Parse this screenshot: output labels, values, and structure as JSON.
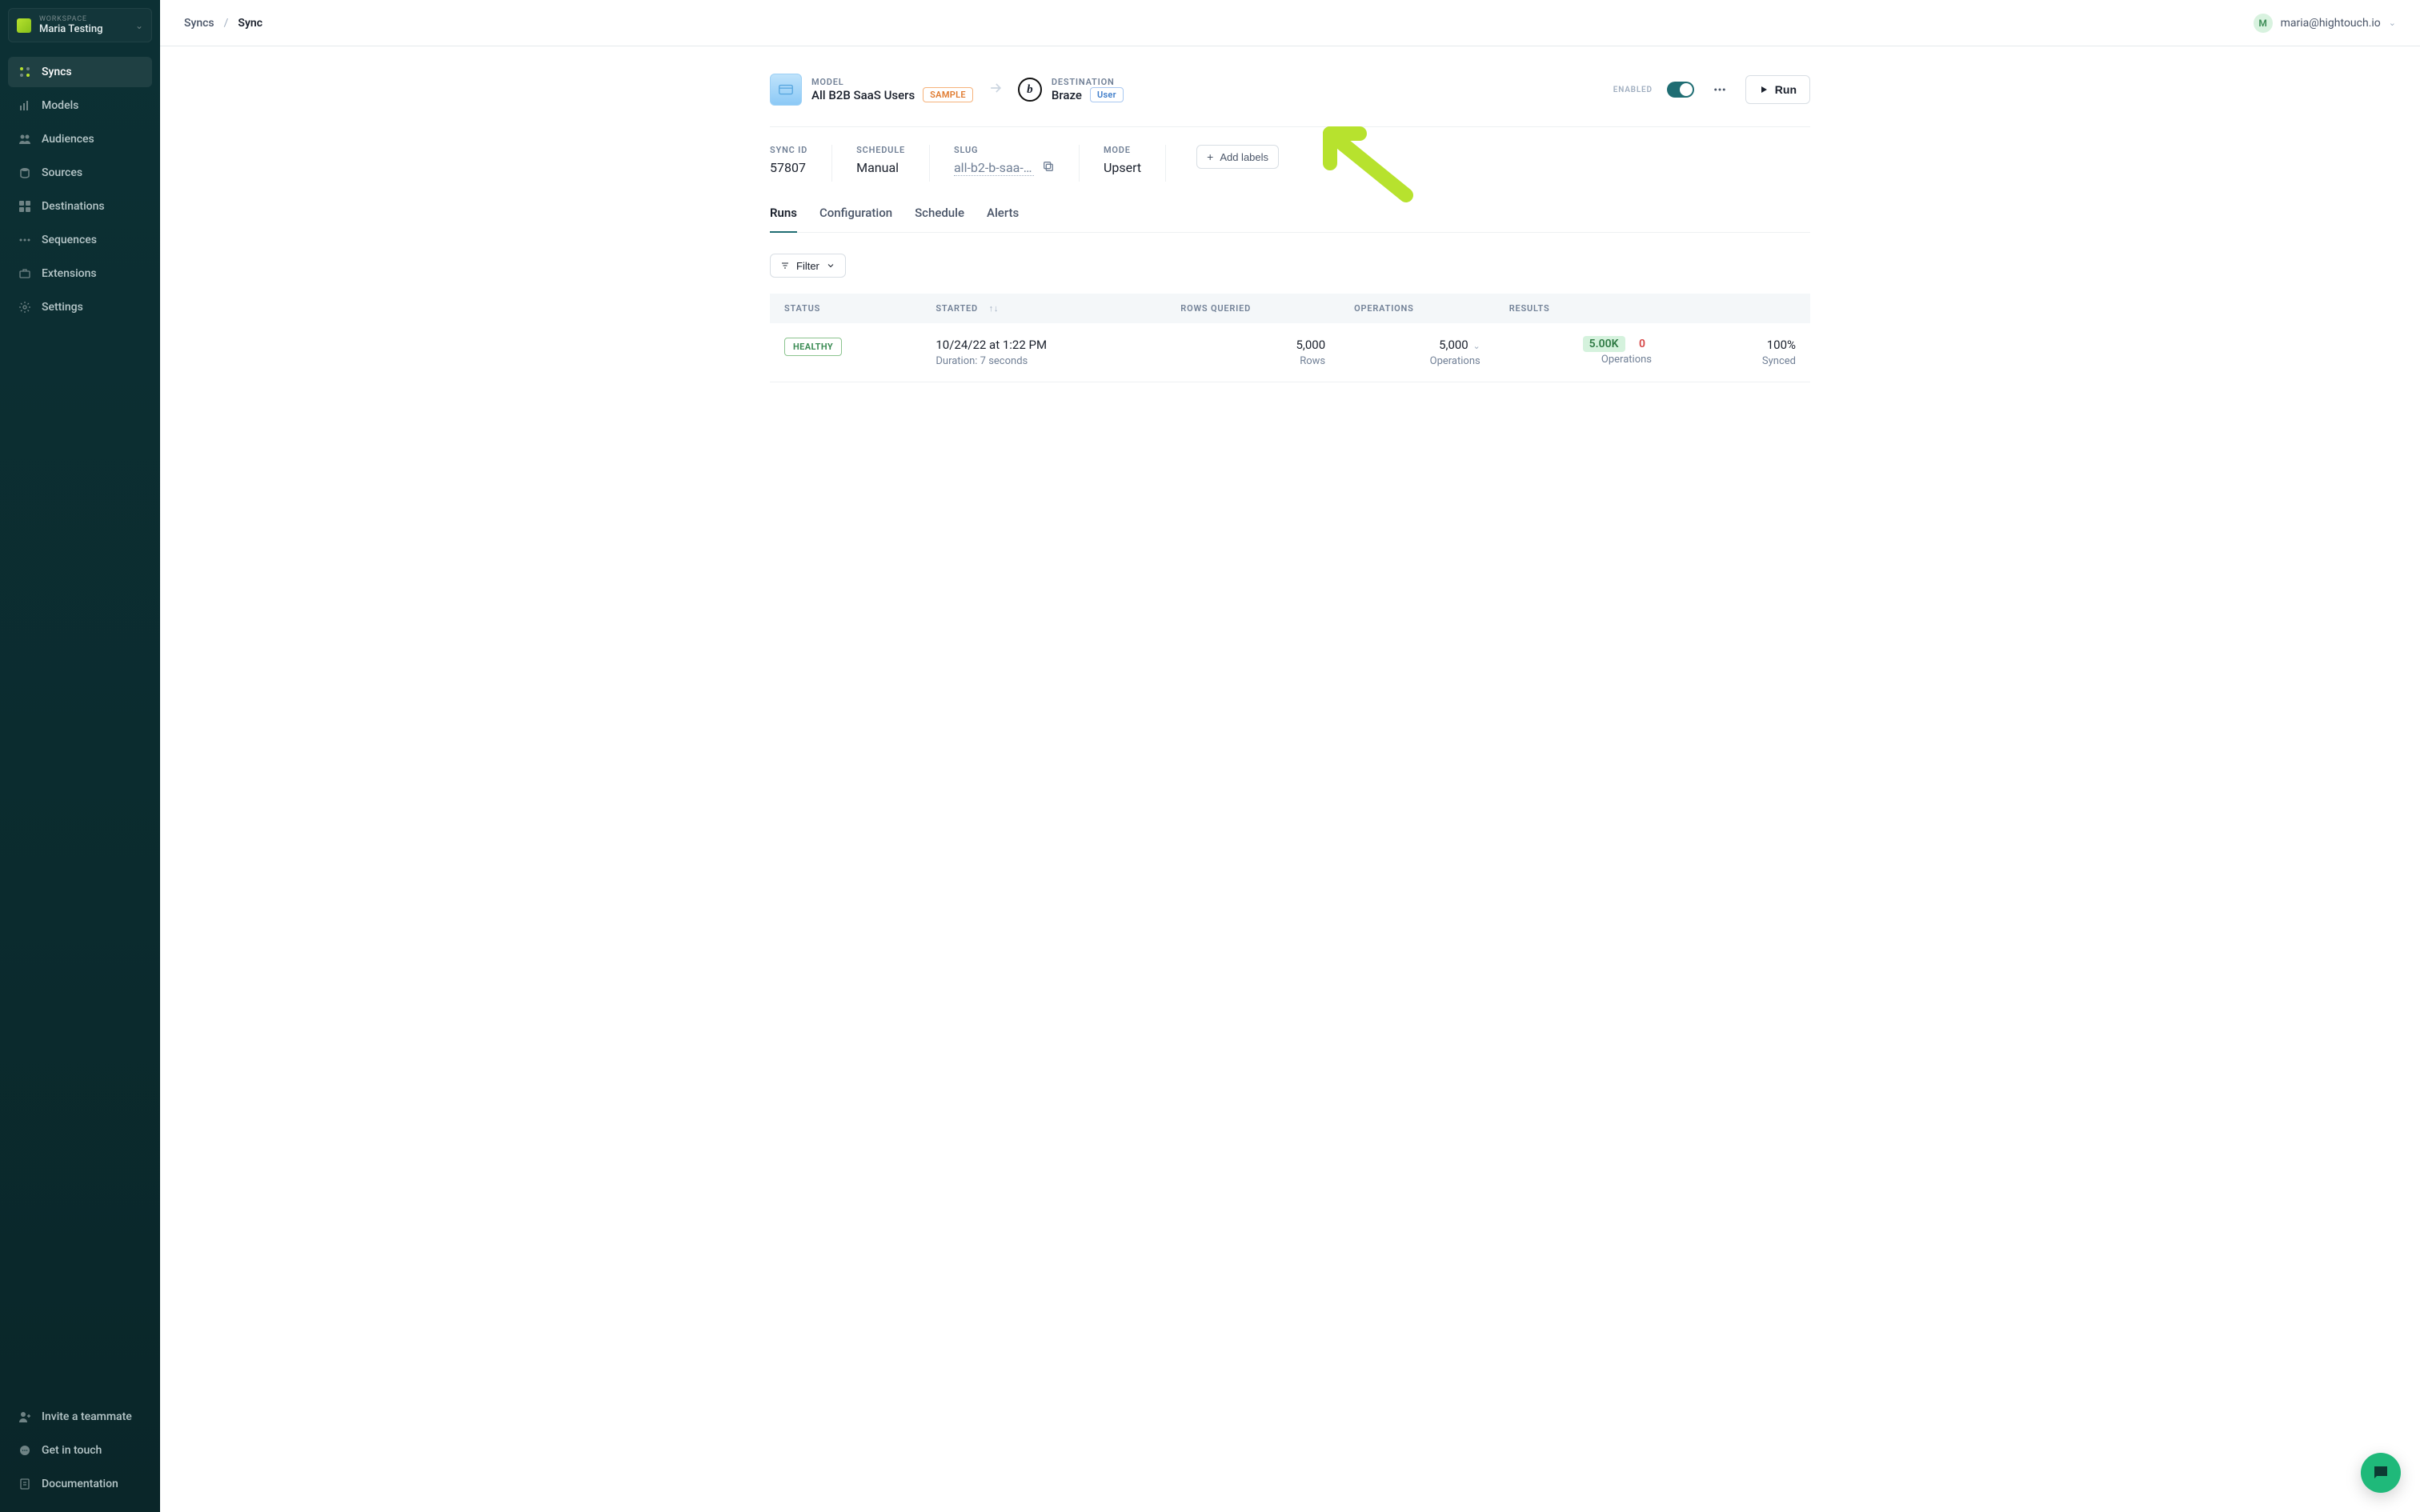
{
  "workspace": {
    "label": "WORKSPACE",
    "name": "Maria Testing"
  },
  "nav": {
    "items": [
      {
        "id": "syncs",
        "label": "Syncs"
      },
      {
        "id": "models",
        "label": "Models"
      },
      {
        "id": "audiences",
        "label": "Audiences"
      },
      {
        "id": "sources",
        "label": "Sources"
      },
      {
        "id": "destinations",
        "label": "Destinations"
      },
      {
        "id": "sequences",
        "label": "Sequences"
      },
      {
        "id": "extensions",
        "label": "Extensions"
      },
      {
        "id": "settings",
        "label": "Settings"
      }
    ],
    "footer": [
      {
        "id": "invite",
        "label": "Invite a teammate"
      },
      {
        "id": "touch",
        "label": "Get in touch"
      },
      {
        "id": "docs",
        "label": "Documentation"
      }
    ]
  },
  "breadcrumb": {
    "parent": "Syncs",
    "current": "Sync"
  },
  "user": {
    "initial": "M",
    "email": "maria@hightouch.io"
  },
  "header": {
    "model_label": "MODEL",
    "model_name": "All B2B SaaS Users",
    "sample_tag": "SAMPLE",
    "dest_label": "DESTINATION",
    "dest_name": "Braze",
    "dest_obj_tag": "User",
    "enabled_label": "ENABLED",
    "run_label": "Run"
  },
  "meta": {
    "sync_id_label": "SYNC ID",
    "sync_id": "57807",
    "schedule_label": "SCHEDULE",
    "schedule": "Manual",
    "slug_label": "SLUG",
    "slug": "all-b2-b-saa-s…",
    "mode_label": "MODE",
    "mode": "Upsert",
    "add_labels": "Add labels"
  },
  "tabs": {
    "runs": "Runs",
    "configuration": "Configuration",
    "schedule": "Schedule",
    "alerts": "Alerts"
  },
  "filter_label": "Filter",
  "table": {
    "headers": {
      "status": "STATUS",
      "started": "STARTED",
      "rows": "ROWS QUERIED",
      "ops": "OPERATIONS",
      "results": "RESULTS",
      "synced": ""
    },
    "rows": [
      {
        "status": "HEALTHY",
        "started": "10/24/22 at 1:22 PM",
        "duration": "Duration: 7 seconds",
        "rows_value": "5,000",
        "rows_label": "Rows",
        "ops_value": "5,000",
        "ops_label": "Operations",
        "results_ok": "5.00K",
        "results_err": "0",
        "results_label": "Operations",
        "synced_pct": "100%",
        "synced_label": "Synced"
      }
    ]
  }
}
